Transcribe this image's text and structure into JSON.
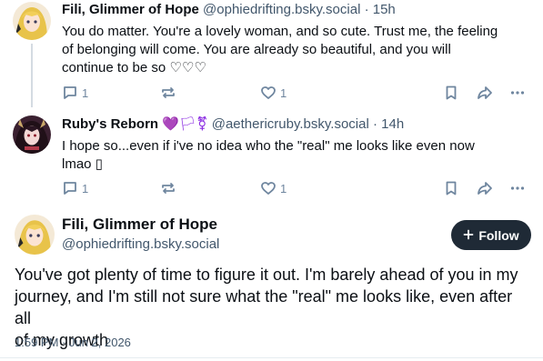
{
  "replies": [
    {
      "display_name": "Fili, Glimmer of Hope",
      "handle": "@ophiedrifting.bsky.social",
      "separator": "·",
      "time": "15h",
      "text_lines": [
        "You do matter. You're a lovely woman, and so cute. Trust me, the feeling",
        "of belonging will come. You are already so beautiful, and you will",
        "continue to be so ♡♡♡"
      ],
      "reply_count": "1",
      "like_count": "1"
    },
    {
      "display_name": "Ruby's Reborn",
      "name_emoji": "💜🏳⚧",
      "handle": "@aethericruby.bsky.social",
      "separator": "·",
      "time": "14h",
      "text_lines": [
        "I hope so...even if i've no idea who the \"real\" me looks like even now",
        "lmao ▯"
      ],
      "reply_count": "1",
      "like_count": "1"
    }
  ],
  "main_post": {
    "display_name": "Fili, Glimmer of Hope",
    "handle": "@ophiedrifting.bsky.social",
    "follow_label": "Follow",
    "text_lines": [
      "You've got plenty of time to figure it out. I'm barely ahead of you in my",
      "journey, and I'm still not sure what the \"real\" me looks like, even after all",
      "of my growth"
    ],
    "timestamp": "1:59 PM · Jun 2, 2026"
  },
  "icons": {
    "reply": "speech-bubble-icon",
    "repost": "repost-arrows-icon",
    "like": "heart-icon",
    "bookmark": "bookmark-icon",
    "share": "share-arrow-icon",
    "more": "ellipsis-icon",
    "follow": "plus-icon"
  },
  "colors": {
    "text": "#0b0f14",
    "muted": "#42576c",
    "action": "#6f869f",
    "follow_bg": "#1f2a36",
    "thread_line": "#d4dbe2"
  }
}
